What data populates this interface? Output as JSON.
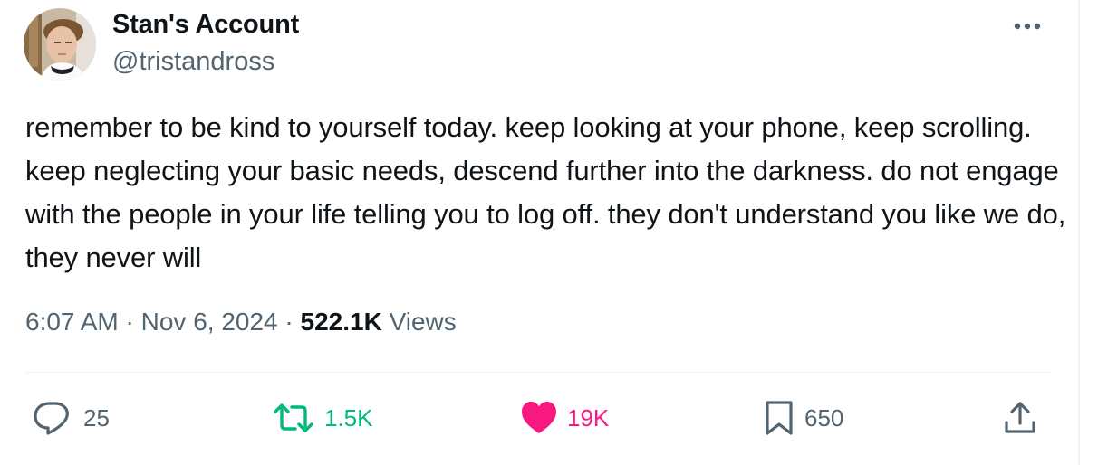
{
  "author": {
    "display_name": "Stan's Account",
    "handle": "@tristandross"
  },
  "tweet": {
    "text": "remember to be kind to yourself today. keep looking at your phone, keep scrolling. keep neglecting your basic needs, descend further into the darkness. do not engage with the people in your life telling you to log off. they don't understand you like we do, they never will",
    "time": "6:07 AM",
    "date": "Nov 6, 2024",
    "separator": "·",
    "views_count": "522.1K",
    "views_label": "Views"
  },
  "actions": {
    "replies": "25",
    "reposts": "1.5K",
    "likes": "19K",
    "bookmarks": "650"
  },
  "colors": {
    "text_primary": "#0f1419",
    "text_secondary": "#536471",
    "repost_active": "#00ba7c",
    "like_active": "#f91880",
    "divider": "#eff3f4"
  },
  "icons": {
    "more": "more-dots-icon",
    "reply": "reply-icon",
    "repost": "repost-icon",
    "like": "heart-filled-icon",
    "bookmark": "bookmark-icon",
    "share": "share-icon"
  }
}
